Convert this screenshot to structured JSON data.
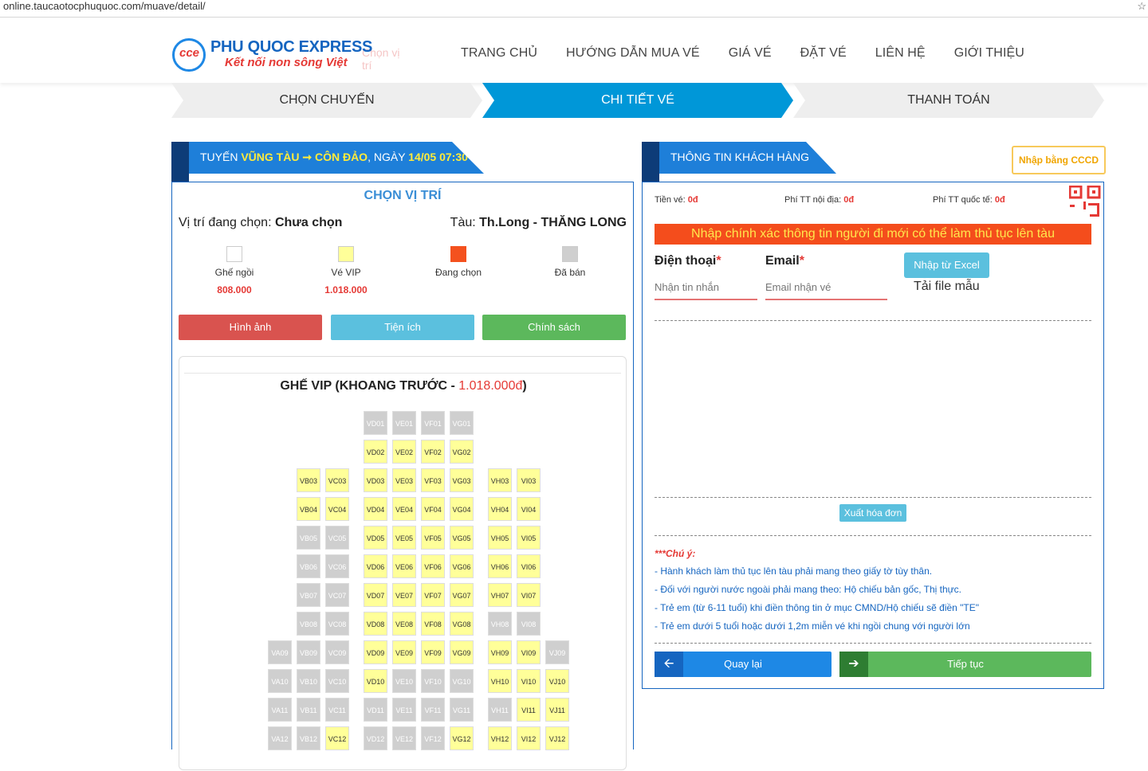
{
  "browser": {
    "url": "online.taucaotocphuquoc.com/muave/detail/",
    "star": "☆"
  },
  "header": {
    "logo_mark": "cce",
    "brand": "PHU QUOC EXPRESS",
    "slogan": "Kết nối non sông Việt",
    "ghost": "Chọn vị trí",
    "nav": [
      "TRANG CHỦ",
      "HƯỚNG DẪN MUA VÉ",
      "GIÁ VÉ",
      "ĐẶT VÉ",
      "LIÊN HỆ",
      "GIỚI THIỆU"
    ]
  },
  "steps": {
    "step1": "CHỌN CHUYẾN",
    "step2": "CHI TIẾT VÉ",
    "step3": "THANH TOÁN",
    "active": "CHI TIẾT VÉ"
  },
  "trip": {
    "prefix": "TUYẾN ",
    "route": "VŨNG TÀU ➞ CÔN ĐẢO",
    "mid": ", NGÀY ",
    "date": "14/05 07:30"
  },
  "seat_panel": {
    "title": "CHỌN VỊ TRÍ",
    "selected_label": "Vị trí đang chọn: ",
    "selected_value": "Chưa chọn",
    "ship_label": "Tàu: ",
    "ship_value": "Th.Long - THĂNG LONG",
    "legend": [
      {
        "label": "Ghế ngồi",
        "price": "808.000",
        "color": "#ffffff"
      },
      {
        "label": "Vé VIP",
        "price": "1.018.000",
        "color": "#ffff99"
      },
      {
        "label": "Đang chọn",
        "price": "",
        "color": "#f4511e"
      },
      {
        "label": "Đã bán",
        "price": "",
        "color": "#cfcfcf"
      }
    ],
    "buttons": {
      "images": "Hình ảnh",
      "amenities": "Tiện ích",
      "policy": "Chính sách"
    },
    "section_title": "GHẾ VIP (KHOANG TRƯỚC - ",
    "section_price": "1.018.000đ",
    "section_close": ")"
  },
  "seats": [
    {
      "rows": [
        [
          "",
          "",
          "",
          "VD01:s",
          "VE01:s",
          "VF01:s",
          "VG01:s",
          "",
          "",
          ""
        ],
        [
          "",
          "",
          "",
          "VD02:v",
          "VE02:v",
          "VF02:v",
          "VG02:v",
          "",
          "",
          ""
        ],
        [
          "",
          "VB03:v",
          "VC03:v",
          "VD03:v",
          "VE03:v",
          "VF03:v",
          "VG03:v",
          "VH03:v",
          "VI03:v",
          ""
        ],
        [
          "",
          "VB04:v",
          "VC04:v",
          "VD04:v",
          "VE04:v",
          "VF04:v",
          "VG04:v",
          "VH04:v",
          "VI04:v",
          ""
        ],
        [
          "",
          "VB05:s",
          "VC05:s",
          "VD05:v",
          "VE05:v",
          "VF05:v",
          "VG05:v",
          "VH05:v",
          "VI05:v",
          ""
        ],
        [
          "",
          "VB06:s",
          "VC06:s",
          "VD06:v",
          "VE06:v",
          "VF06:v",
          "VG06:v",
          "VH06:v",
          "VI06:v",
          ""
        ],
        [
          "",
          "VB07:s",
          "VC07:s",
          "VD07:v",
          "VE07:v",
          "VF07:v",
          "VG07:v",
          "VH07:v",
          "VI07:v",
          ""
        ],
        [
          "",
          "VB08:s",
          "VC08:s",
          "VD08:v",
          "VE08:v",
          "VF08:v",
          "VG08:v",
          "VH08:s",
          "VI08:s",
          ""
        ],
        [
          "VA09:s",
          "VB09:s",
          "VC09:s",
          "VD09:v",
          "VE09:v",
          "VF09:v",
          "VG09:v",
          "VH09:v",
          "VI09:v",
          "VJ09:s"
        ],
        [
          "VA10:s",
          "VB10:s",
          "VC10:s",
          "VD10:v",
          "VE10:s",
          "VF10:s",
          "VG10:s",
          "VH10:v",
          "VI10:v",
          "VJ10:v"
        ],
        [
          "VA11:s",
          "VB11:s",
          "VC11:s",
          "VD11:s",
          "VE11:s",
          "VF11:s",
          "VG11:s",
          "VH11:s",
          "VI11:v",
          "VJ11:v"
        ],
        [
          "VA12:s",
          "VB12:s",
          "VC12:v",
          "VD12:s",
          "VE12:s",
          "VF12:s",
          "VG12:v",
          "VH12:v",
          "VI12:v",
          "VJ12:v"
        ]
      ]
    }
  ],
  "customer": {
    "title": "THÔNG TIN KHÁCH HÀNG",
    "cccd_button": "Nhập bằng CCCD",
    "fees": [
      {
        "label": "Tiền vé: ",
        "value": "0đ"
      },
      {
        "label": "Phí TT nội địa: ",
        "value": "0đ"
      },
      {
        "label": "Phí TT quốc tế: ",
        "value": "0đ"
      }
    ],
    "warning": "Nhập chính xác thông tin người đi mới có thể làm thủ tục lên tàu",
    "phone_label": "Điện thoại",
    "phone_placeholder": "Nhận tin nhắn",
    "email_label": "Email",
    "email_placeholder": "Email nhận vé",
    "req": "*",
    "excel_button": "Nhập từ Excel",
    "template_link": "Tải file mẫu",
    "invoice_button": "Xuất hóa đơn",
    "note_title": "***Chú ý:",
    "notes": [
      "- Hành khách làm thủ tục lên tàu phải mang theo giấy tờ tùy thân.",
      "- Đối với người nước ngoài phải mang theo: Hộ chiếu bản gốc, Thị thực.",
      "- Trẻ em (từ 6-11 tuổi) khi điền thông tin ở mục CMND/Hộ chiếu sẽ điền \"TE\"",
      "- Trẻ em dưới 5 tuổi hoặc dưới 1,2m miễn vé khi ngồi chung với người lớn"
    ],
    "back_button": "Quay lại",
    "next_button": "Tiếp tục",
    "back_icon": "arrow-left-icon",
    "next_icon": "arrow-right-icon"
  }
}
